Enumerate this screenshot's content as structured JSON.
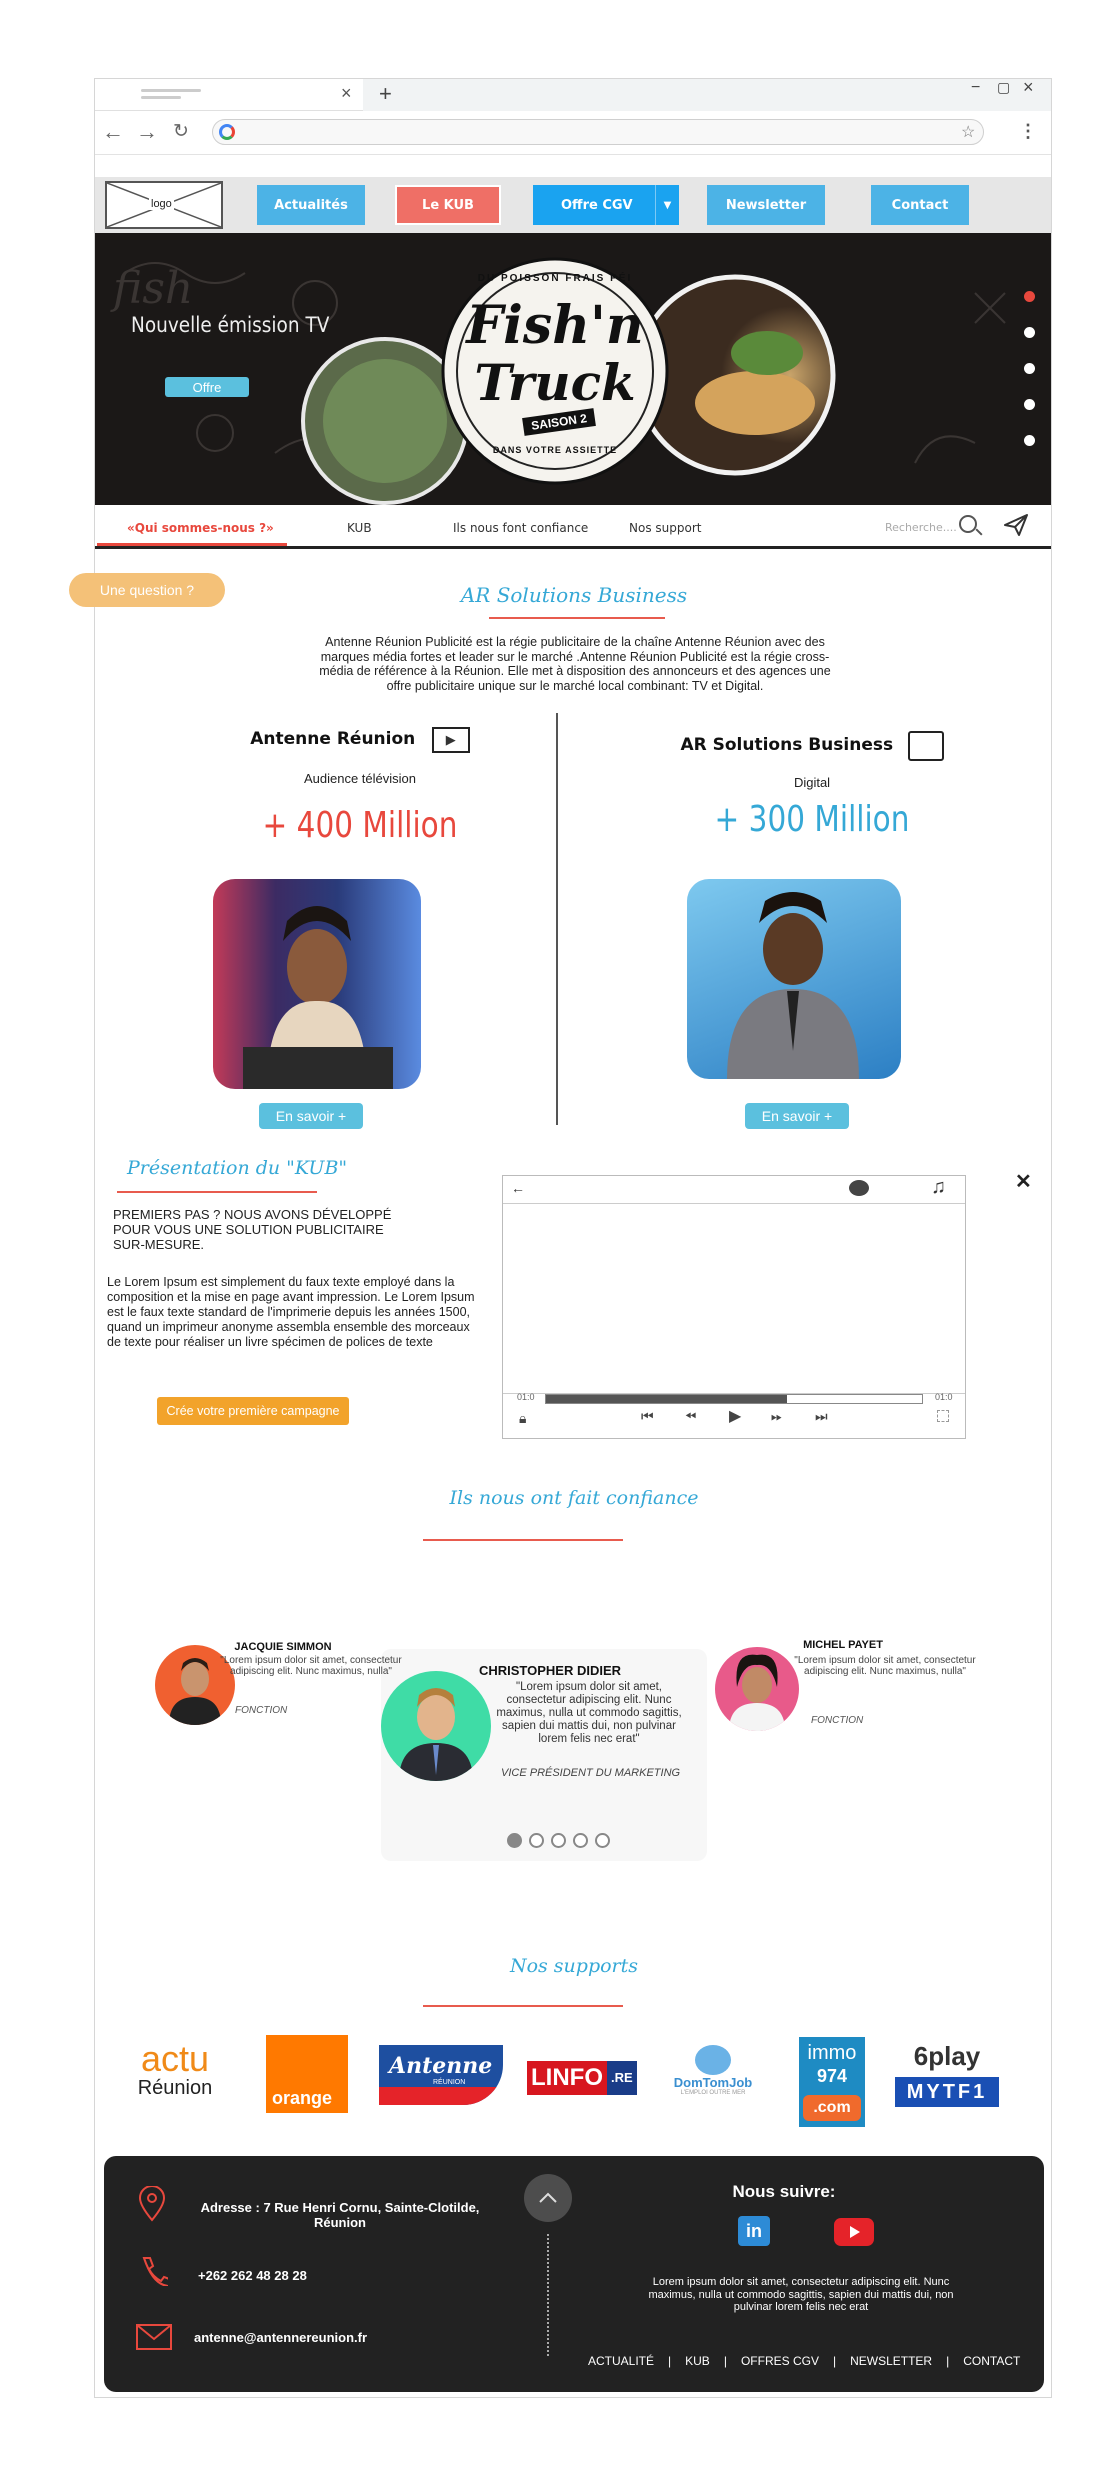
{
  "browser": {
    "new_tab": "+",
    "close_tab": "×",
    "window_min": "−",
    "window_max": "▢",
    "window_close": "×"
  },
  "nav": {
    "logo": "logo",
    "items": [
      {
        "label": "Actualités",
        "color": "#4cb3e6"
      },
      {
        "label": "Le KUB",
        "color": "#ef6f66"
      },
      {
        "label": "Offre CGV",
        "color": "#1aa3f0"
      },
      {
        "label": "Newsletter",
        "color": "#4cb3e6"
      },
      {
        "label": "Contact",
        "color": "#4cb3e6"
      }
    ]
  },
  "hero": {
    "heading": "Nouvelle émission TV",
    "button": "Offre",
    "logo_top": "DU POISSON FRAIS PÉI",
    "logo_main1": "Fish'n",
    "logo_main2": "Truck",
    "logo_season": "SAISON 2",
    "logo_bottom": "DANS VOTRE ASSIETTE",
    "bg_word": "fish"
  },
  "subnav": {
    "items": [
      "«Qui sommes-nous ?»",
      "KUB",
      "Ils nous font confiance",
      "Nos support"
    ],
    "search_placeholder": "Recherche...."
  },
  "question_button": "Une question ?",
  "about": {
    "title": "AR Solutions Business",
    "text": "Antenne Réunion Publicité est la régie publicitaire de la chaîne Antenne Réunion avec des marques média fortes et leader sur le marché .Antenne Réunion Publicité est la régie cross-média de référence à la Réunion. Elle met à disposition des annonceurs et des agences une offre publicitaire unique sur le marché local combinant: TV et Digital."
  },
  "stats": [
    {
      "name": "Antenne Réunion",
      "sub": "Audience télévision",
      "value": "+ 400 Million",
      "button": "En savoir +"
    },
    {
      "name": "AR Solutions Business",
      "sub": "Digital",
      "value": "+ 300 Million",
      "button": "En savoir +"
    }
  ],
  "kub": {
    "title": "Présentation du \"KUB\"",
    "heading": "PREMIERS PAS ? NOUS AVONS DÉVELOPPÉ POUR VOUS UNE SOLUTION PUBLICITAIRE SUR-MESURE.",
    "body": "Le Lorem Ipsum est simplement du faux texte employé dans la composition et la mise en page avant impression. Le Lorem Ipsum est le faux texte standard de l'imprimerie depuis les années 1500, quand un imprimeur anonyme assembla ensemble des morceaux de texte pour réaliser un livre spécimen de polices de texte",
    "button": "Crée votre première campagne"
  },
  "player": {
    "back": "←",
    "time_start": "01:0",
    "time_end": "01:0",
    "progress": 0.64
  },
  "testimonials": {
    "title": "Ils nous ont fait confiance",
    "items": [
      {
        "name": "JACQUIE SIMMON",
        "quote": "\"Lorem ipsum dolor sit amet, consectetur adipiscing elit. Nunc maximus, nulla\"",
        "role": "FONCTION"
      },
      {
        "name": "CHRISTOPHER DIDIER",
        "quote": "\"Lorem ipsum dolor sit amet, consectetur adipiscing elit. Nunc maximus, nulla ut commodo sagittis, sapien dui mattis dui, non pulvinar lorem felis nec erat\"",
        "role": "VICE PRÉSIDENT DU MARKETING"
      },
      {
        "name": "MICHEL PAYET",
        "quote": "\"Lorem ipsum dolor sit amet, consectetur adipiscing elit. Nunc maximus, nulla\"",
        "role": "FONCTION"
      }
    ],
    "active_slide": 1,
    "slide_count": 5
  },
  "supports": {
    "title": "Nos supports",
    "logos": {
      "actu1": "actu",
      "actu2": "Réunion",
      "orange": "orange",
      "antenne": "Antenne",
      "antenne_sub": "RÉUNION",
      "linfo": "LINFO",
      "linfo_re": ".RE",
      "domtom": "DomTomJob",
      "domtom_sub": "L'EMPLOI OUTRE MER",
      "immo1": "immo",
      "immo2": "974",
      "immo3": ".com",
      "sixplay": "6play",
      "mytf1": "MYTF1"
    }
  },
  "footer": {
    "address": "Adresse : 7 Rue Henri Cornu, Sainte-Clotilde, Réunion",
    "phone": "+262 262 48 28 28",
    "email": "antenne@antennereunion.fr",
    "follow": "Nous suivre:",
    "linkedin": "in",
    "text": "Lorem ipsum dolor sit amet, consectetur adipiscing elit. Nunc maximus, nulla ut commodo sagittis, sapien dui mattis dui, non pulvinar lorem felis nec erat",
    "links": [
      "ACTUALITÉ",
      "KUB",
      "OFFRES CGV",
      "NEWSLETTER",
      "CONTACT"
    ],
    "separator": "|"
  }
}
